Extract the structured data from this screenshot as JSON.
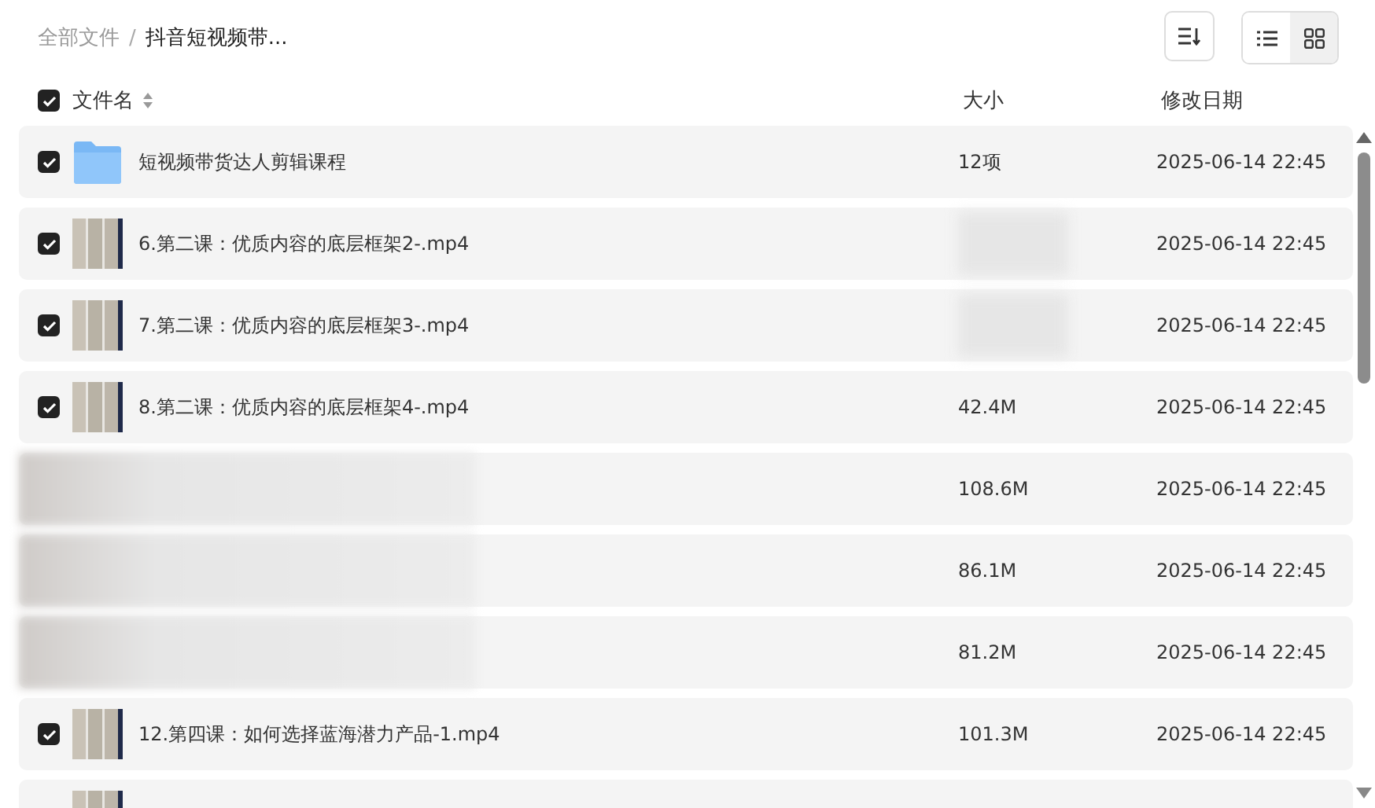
{
  "breadcrumb": [
    {
      "label": "全部文件",
      "current": false
    },
    {
      "separator": "/",
      "label": "抖音短视频带...",
      "current": true
    }
  ],
  "view_toggle": [
    {
      "kind": "list",
      "selected": false
    },
    {
      "kind": "grid",
      "selected": true
    }
  ],
  "header": {
    "checked": true,
    "name": "文件名",
    "size": "大小",
    "date": "修改日期"
  },
  "rows": [
    {
      "kind": "folder",
      "checked": true,
      "name": "短视频带货达人剪辑课程",
      "size": "12项",
      "date": "2025-06-14 22:45"
    },
    {
      "kind": "video",
      "checked": true,
      "name": "6.第二课：优质内容的底层框架2-.mp4",
      "date": "2025-06-14 22:45"
    },
    {
      "kind": "video",
      "checked": true,
      "name": "7.第二课：优质内容的底层框架3-.mp4",
      "date": "2025-06-14 22:45"
    },
    {
      "kind": "video",
      "checked": true,
      "name": "8.第二课：优质内容的底层框架4-.mp4",
      "size": "42.4M",
      "date": "2025-06-14 22:45"
    },
    {
      "kind": "blurred",
      "size": "108.6M",
      "date": "2025-06-14 22:45"
    },
    {
      "kind": "blurred",
      "size": "86.1M",
      "date": "2025-06-14 22:45"
    },
    {
      "kind": "blurred",
      "size": "81.2M",
      "date": "2025-06-14 22:45"
    },
    {
      "kind": "video",
      "checked": true,
      "name": "12.第四课：如何选择蓝海潜力产品-1.mp4",
      "size": "101.3M",
      "date": "2025-06-14 22:45"
    },
    {
      "kind": "video"
    }
  ]
}
